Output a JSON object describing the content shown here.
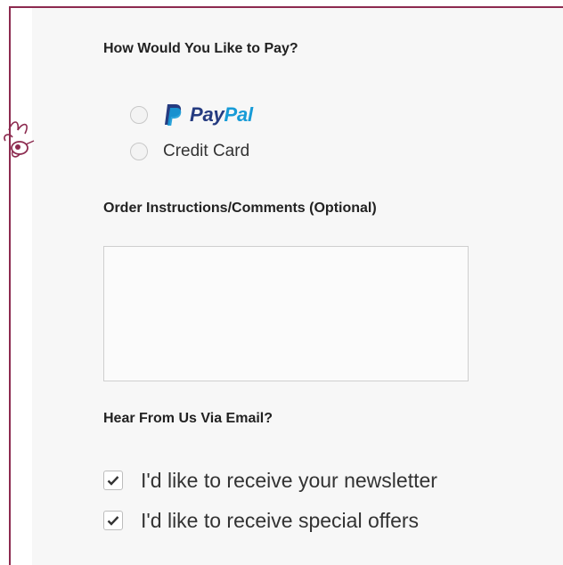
{
  "payment": {
    "heading": "How Would You Like to Pay?",
    "options": [
      {
        "label_part1": "Pay",
        "label_part2": "Pal",
        "selected": false,
        "icon": "paypal-logo-icon"
      },
      {
        "label": "Credit Card",
        "selected": false
      }
    ]
  },
  "comments": {
    "heading": "Order Instructions/Comments (Optional)",
    "value": ""
  },
  "email": {
    "heading": "Hear From Us Via Email?",
    "options": [
      {
        "label": "I'd like to receive your newsletter",
        "checked": true
      },
      {
        "label": "I'd like to receive special offers",
        "checked": true
      }
    ]
  },
  "colors": {
    "frame": "#8c2a4f",
    "paypal_dark": "#253b80",
    "paypal_light": "#179bd7"
  }
}
